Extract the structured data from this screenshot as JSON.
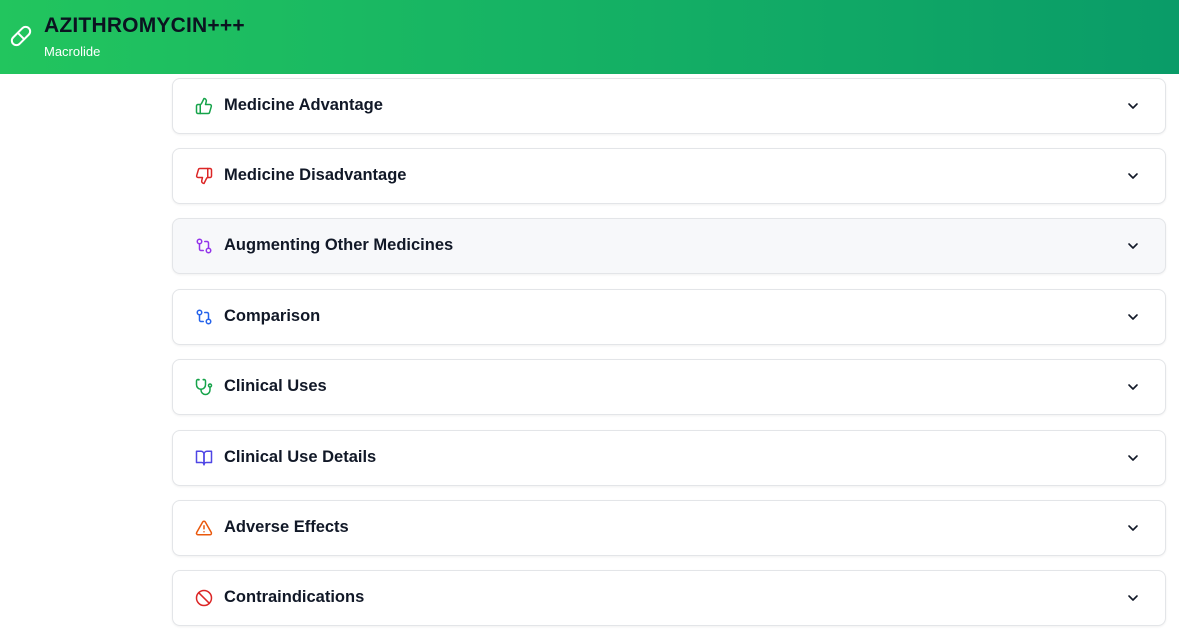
{
  "header": {
    "title": "AZITHROMYCIN+++",
    "subtitle": "Macrolide",
    "icon": "pill-icon"
  },
  "sections": [
    {
      "label": "Medicine Advantage",
      "icon": "thumbs-up-icon",
      "color": "#16a34a"
    },
    {
      "label": "Medicine Disadvantage",
      "icon": "thumbs-down-icon",
      "color": "#dc2626"
    },
    {
      "label": "Augmenting Other Medicines",
      "icon": "git-compare-icon",
      "color": "#9333ea"
    },
    {
      "label": "Comparison",
      "icon": "git-compare-icon",
      "color": "#2563eb"
    },
    {
      "label": "Clinical Uses",
      "icon": "stethoscope-icon",
      "color": "#16a34a"
    },
    {
      "label": "Clinical Use Details",
      "icon": "book-open-icon",
      "color": "#4f46e5"
    },
    {
      "label": "Adverse Effects",
      "icon": "alert-triangle-icon",
      "color": "#ea580c"
    },
    {
      "label": "Contraindications",
      "icon": "ban-icon",
      "color": "#dc2626"
    }
  ]
}
